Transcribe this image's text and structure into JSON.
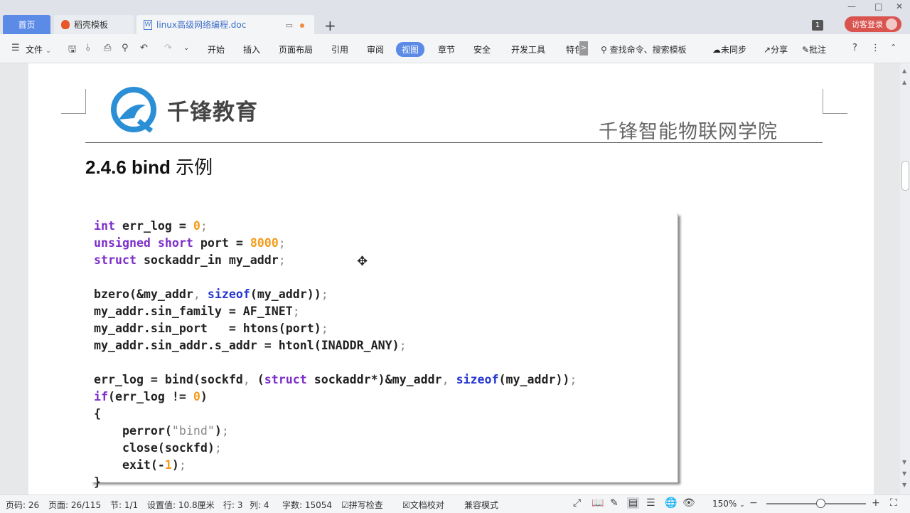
{
  "tabs": {
    "home": "首页",
    "template": "稻壳模板",
    "document": "linux高级网络编程.doc"
  },
  "titlebar": {
    "badge": "1",
    "visitor_login": "访客登录"
  },
  "menu": {
    "file": "文件",
    "items": [
      "开始",
      "插入",
      "页面布局",
      "引用",
      "审阅",
      "视图",
      "章节",
      "安全",
      "开发工具",
      "特色"
    ],
    "active": "视图",
    "search": "查找命令、搜索模板",
    "sync": "未同步",
    "share": "分享",
    "comment": "批注"
  },
  "document": {
    "logo_text": "千锋教育",
    "header_right": "千锋智能物联网学院",
    "heading_num": "2.4.6 bind",
    "heading_cn": "示例"
  },
  "status": {
    "page_num": "页码: 26",
    "pages": "页面: 26/115",
    "section": "节: 1/1",
    "setting": "设置值: 10.8厘米",
    "row": "行: 3",
    "col": "列: 4",
    "word_count": "字数: 15054",
    "spell_check": "拼写检查",
    "doc_check": "文档校对",
    "compat_mode": "兼容模式",
    "zoom": "150%"
  },
  "colors": {
    "accent": "#5b8be6",
    "keyword": "#7d2ec9",
    "builtin": "#2436d0",
    "number": "#f39b1c",
    "visitor": "#d9534f"
  }
}
